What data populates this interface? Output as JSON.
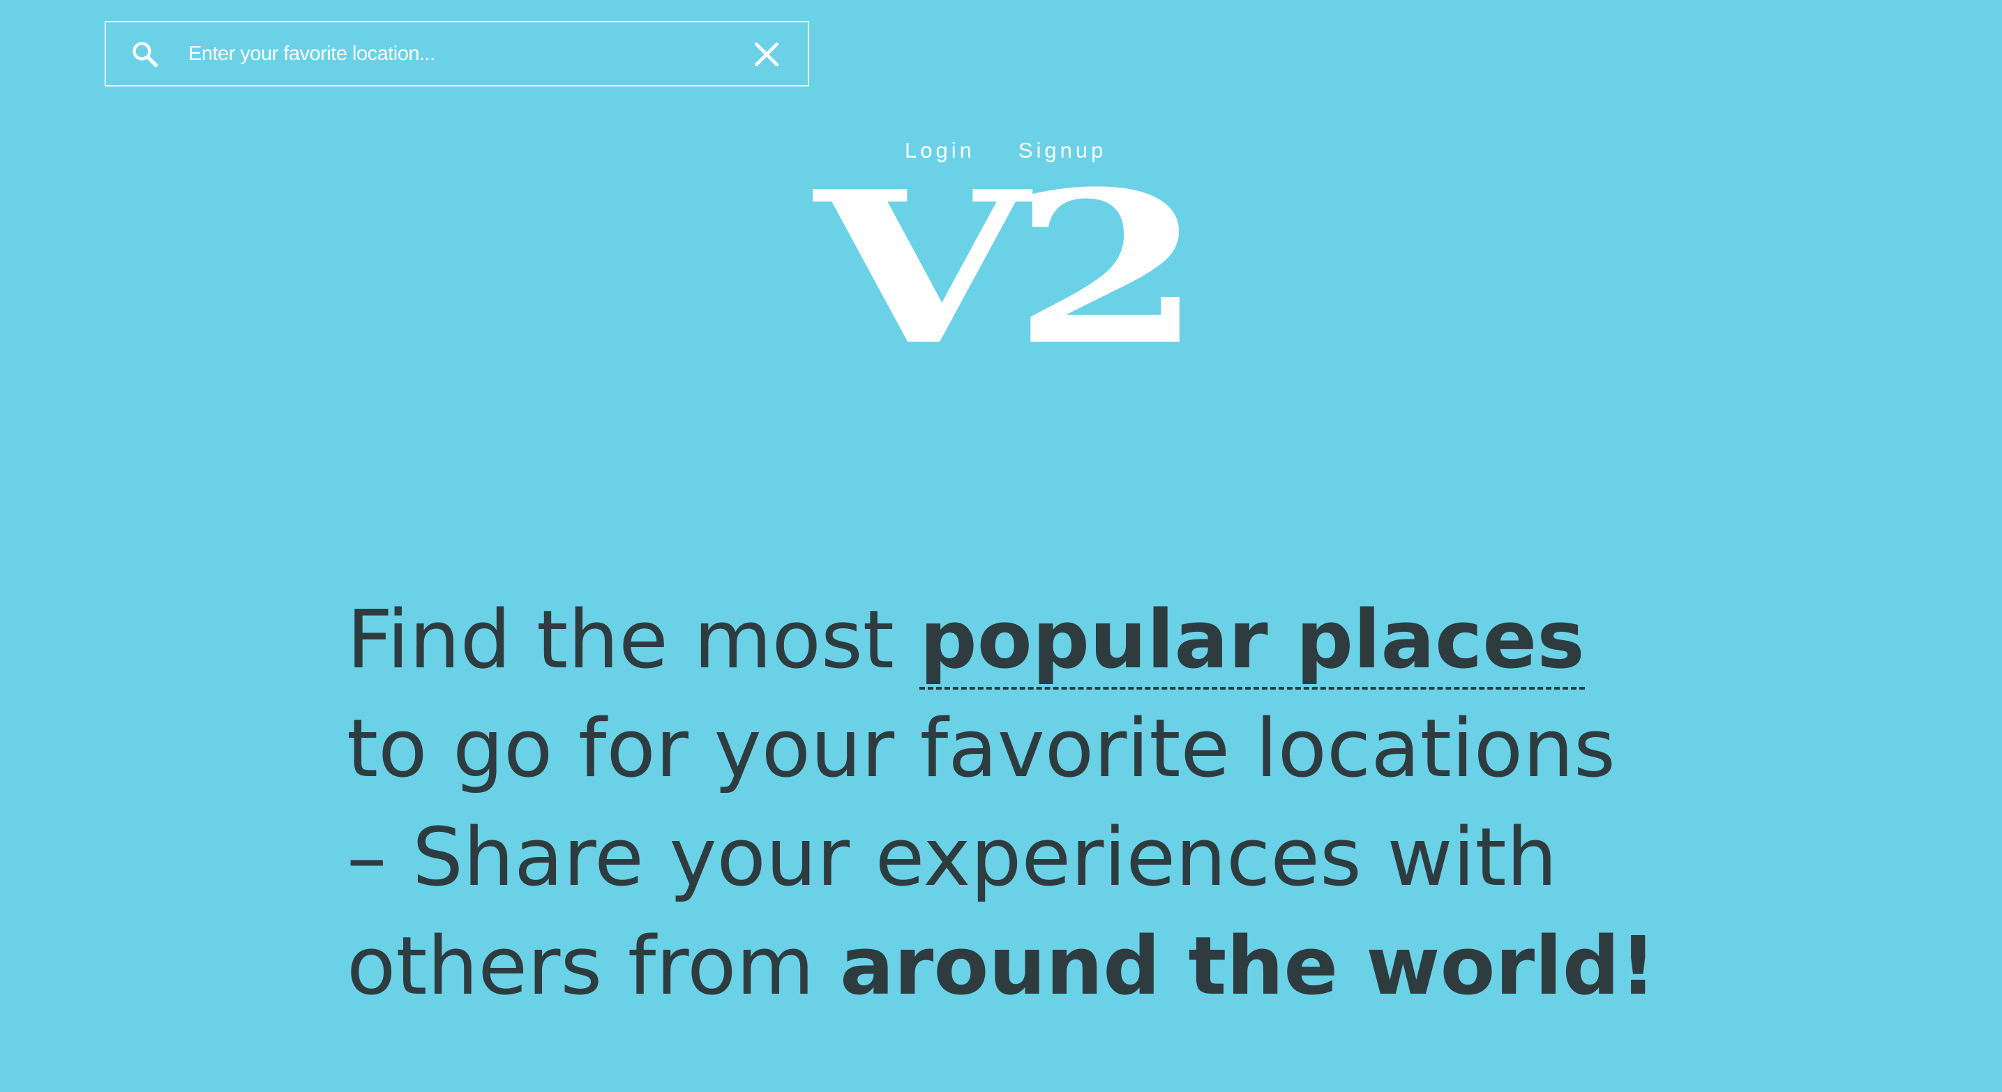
{
  "search": {
    "placeholder": "Enter your favorite location...",
    "value": "",
    "icon": "search-icon",
    "clear_icon": "close-icon"
  },
  "nav": {
    "login": "Login",
    "signup": "Signup"
  },
  "logo": {
    "text": "V2"
  },
  "headline": {
    "part1": "Find the most ",
    "link": "popular places",
    "part2": " to go for your favorite locations – Share your experiences with others from ",
    "emphasis": "around the world!"
  },
  "colors": {
    "background": "#6bd1e6",
    "text": "#2e3c40",
    "accent": "#ffffff"
  }
}
